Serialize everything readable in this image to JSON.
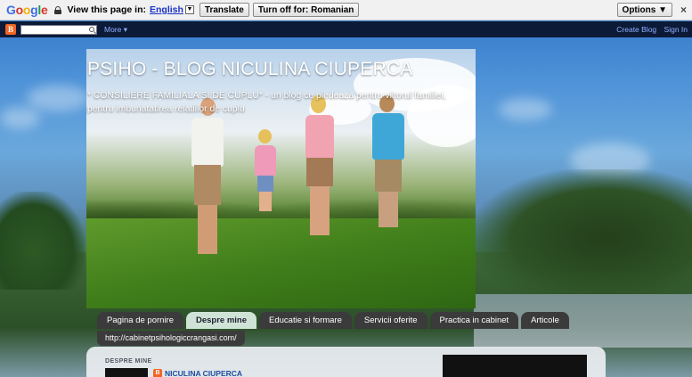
{
  "translate_bar": {
    "logo_letters": [
      "G",
      "o",
      "o",
      "g",
      "l",
      "e"
    ],
    "prompt": "View this page in:",
    "language": "English",
    "translate_button": "Translate",
    "turn_off_button": "Turn off for: Romanian",
    "options_button": "Options ▼",
    "close_glyph": "×"
  },
  "navbar": {
    "blogger_glyph": "B",
    "more_label": "More ▾",
    "create_blog": "Create Blog",
    "sign_in": "Sign In"
  },
  "header": {
    "title": "PSIHO - BLOG NICULINA CIUPERCA",
    "description": "* CONSILIERE FAMILIALA SI DE CUPLU* - un blog ce pledeaza pentru viitorul familiei, pentru imbunatatirea relatiilor de cuplu"
  },
  "tabs": [
    {
      "label": "Pagina de pornire",
      "active": false
    },
    {
      "label": "Despre mine",
      "active": true
    },
    {
      "label": "Educatie si formare",
      "active": false
    },
    {
      "label": "Servicii oferite",
      "active": false
    },
    {
      "label": "Practica in cabinet",
      "active": false
    },
    {
      "label": "Articole",
      "active": false
    }
  ],
  "tab_link": "http://cabinetpsihologiccrangasi.com/",
  "profile": {
    "section_title": "DESPRE MINE",
    "name": "NICULINA CIUPERCA",
    "blogger_glyph": "B"
  },
  "colors": {
    "tab_bg": "#3b3b3b",
    "tab_active_bg": "#cfe4d6",
    "navbar_bg": "#0c1a38",
    "link_blue": "#1b4c9e"
  }
}
